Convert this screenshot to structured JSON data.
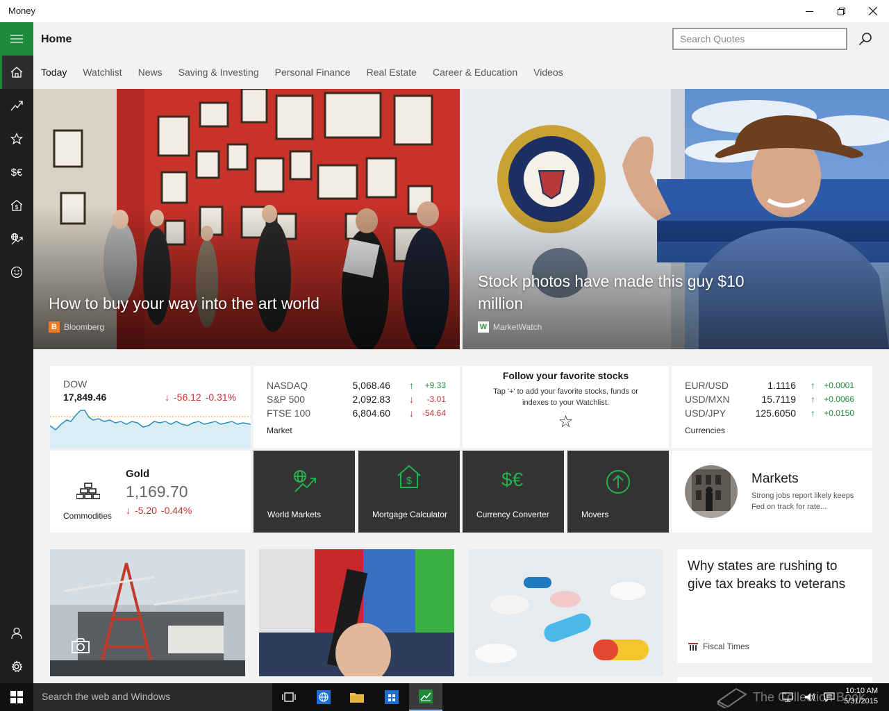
{
  "window": {
    "title": "Money"
  },
  "header": {
    "title": "Home"
  },
  "search": {
    "placeholder": "Search Quotes"
  },
  "tabs": [
    "Today",
    "Watchlist",
    "News",
    "Saving & Investing",
    "Personal Finance",
    "Real Estate",
    "Career & Education",
    "Videos"
  ],
  "hero": [
    {
      "headline": "How to buy your way into the art world",
      "source": "Bloomberg",
      "logo_letter": "B",
      "logo_color": "#f47c20"
    },
    {
      "headline": "Stock photos have made this guy $10 million",
      "source": "MarketWatch",
      "logo_letter": "W",
      "logo_color": "#3a9a3a"
    }
  ],
  "dow": {
    "name": "DOW",
    "value": "17,849.46",
    "change": "-56.12",
    "percent": "-0.31%"
  },
  "market": {
    "caption": "Market",
    "rows": [
      {
        "name": "NASDAQ",
        "value": "5,068.46",
        "change": "+9.33",
        "dir": "up"
      },
      {
        "name": "S&P 500",
        "value": "2,092.83",
        "change": "-3.01",
        "dir": "down"
      },
      {
        "name": "FTSE 100",
        "value": "6,804.60",
        "change": "-54.64",
        "dir": "down"
      }
    ]
  },
  "follow": {
    "title": "Follow your favorite stocks",
    "text": "Tap '+' to add your favorite stocks, funds or indexes to your Watchlist.",
    "star": "☆"
  },
  "currencies": {
    "caption": "Currencies",
    "rows": [
      {
        "name": "EUR/USD",
        "value": "1.1116",
        "change": "+0.0001"
      },
      {
        "name": "USD/MXN",
        "value": "15.7119",
        "change": "+0.0066"
      },
      {
        "name": "USD/JPY",
        "value": "125.6050",
        "change": "+0.0150"
      }
    ]
  },
  "commodities": {
    "caption": "Commodities",
    "name": "Gold",
    "value": "1,169.70",
    "change": "-5.20",
    "percent": "-0.44%"
  },
  "shortcuts": {
    "world_markets": "World Markets",
    "mortgage": "Mortgage Calculator",
    "currency_converter": "Currency Converter",
    "movers": "Movers"
  },
  "markets_news": {
    "title": "Markets",
    "text": "Strong jobs report likely keeps Fed on track for rate..."
  },
  "article": {
    "headline": "Why states are rushing to give tax breaks to veterans",
    "source": "Fiscal Times"
  },
  "taskbar": {
    "search": "Search the web and Windows",
    "time": "10:10 AM",
    "date": "5/31/2015",
    "watermark": "The Collection Book"
  },
  "colors": {
    "accent": "#1e8a3c",
    "up": "#1e8a3c",
    "down": "#c8312f",
    "rail": "#1f1f1f"
  }
}
